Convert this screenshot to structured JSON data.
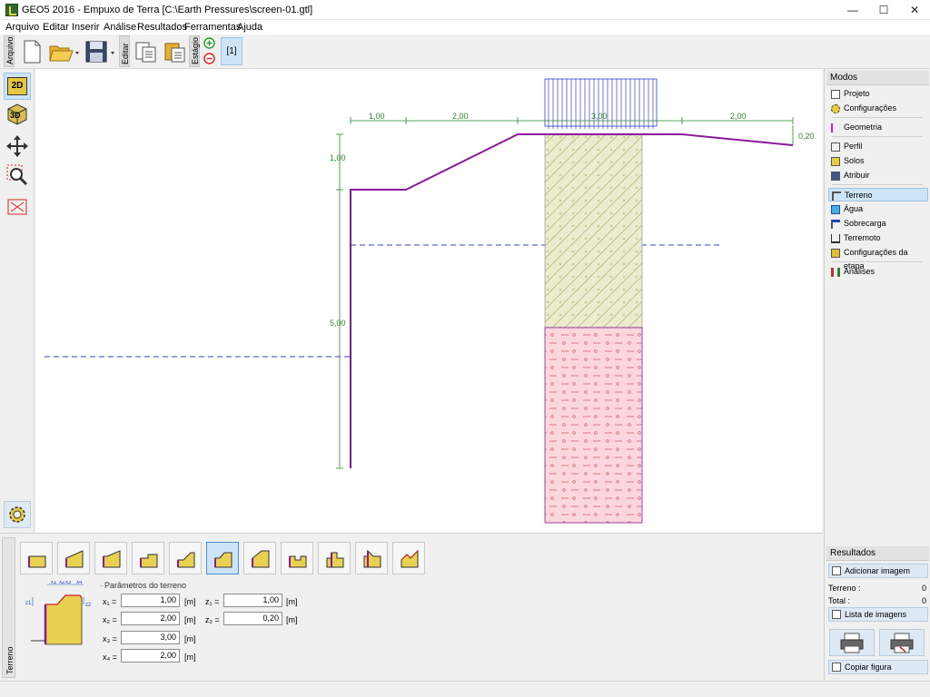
{
  "window": {
    "title": "GEO5 2016 - Empuxo de Terra [C:\\Earth Pressures\\screen-01.gtl]",
    "minimize": "—",
    "maximize": "☐",
    "close": "✕"
  },
  "menu": [
    "Arquivo",
    "Editar",
    "Inserir",
    "Análise",
    "Resultados",
    "Ferramentas",
    "Ajuda"
  ],
  "toolbar": {
    "arquivo_tab": "Arquivo",
    "editar_tab": "Editar",
    "estagio_tab": "Estágio",
    "stage_button": "[1]"
  },
  "view": {
    "btn_2d": "2D",
    "btn_3d": "3D"
  },
  "drawing": {
    "dim_x1": "1,00",
    "dim_x2": "2,00",
    "dim_x3": "3,00",
    "dim_x4": "2,00",
    "dim_z2": "0,20",
    "dim_z1": "1,00",
    "dim_height": "5,00"
  },
  "modes": {
    "header": "Modos",
    "items": [
      {
        "label": "Projeto",
        "icon": "document-icon"
      },
      {
        "label": "Configurações",
        "icon": "gear-icon"
      },
      {
        "label": "Geometria",
        "icon": "geometry-icon"
      },
      {
        "label": "Perfil",
        "icon": "profile-icon"
      },
      {
        "label": "Solos",
        "icon": "soils-icon"
      },
      {
        "label": "Atribuir",
        "icon": "assign-icon"
      },
      {
        "label": "Terreno",
        "icon": "terrain-icon"
      },
      {
        "label": "Água",
        "icon": "water-icon"
      },
      {
        "label": "Sobrecarga",
        "icon": "surcharge-icon"
      },
      {
        "label": "Terremoto",
        "icon": "earthquake-icon"
      },
      {
        "label": "Configurações da etapa",
        "icon": "stage-settings-icon"
      },
      {
        "label": "Análises",
        "icon": "analysis-icon"
      }
    ],
    "active": "Terreno"
  },
  "terrain_panel": {
    "tab_label": "Terreno",
    "group_title": "Parâmetros do terreno",
    "diagram_labels": {
      "x1": "x1",
      "x2": "x2",
      "x3": "x3",
      "x4": "x4",
      "z1": "z1",
      "z2": "z2"
    },
    "fields": [
      {
        "label": "x₁ =",
        "value": "1,00",
        "unit": "[m]"
      },
      {
        "label": "x₂ =",
        "value": "2,00",
        "unit": "[m]"
      },
      {
        "label": "x₃ =",
        "value": "3,00",
        "unit": "[m]"
      },
      {
        "label": "x₄ =",
        "value": "2,00",
        "unit": "[m]"
      },
      {
        "label": "z₁ =",
        "value": "1,00",
        "unit": "[m]"
      },
      {
        "label": "z₂ =",
        "value": "0,20",
        "unit": "[m]"
      }
    ],
    "selected_type": 6
  },
  "results": {
    "header": "Resultados",
    "add_image": "Adicionar imagem",
    "terrain_label": "Terreno :",
    "terrain_count": "0",
    "total_label": "Total :",
    "total_count": "0",
    "image_list": "Lista de imagens",
    "copy_figure": "Copiar figura"
  },
  "colors": {
    "accent": "#cde4f7",
    "wall": "#8b1a9b",
    "dims": "#2a8a2a",
    "water": "#3040d0",
    "soil1": "#ecebd0",
    "soil2": "#fbd6dc"
  }
}
